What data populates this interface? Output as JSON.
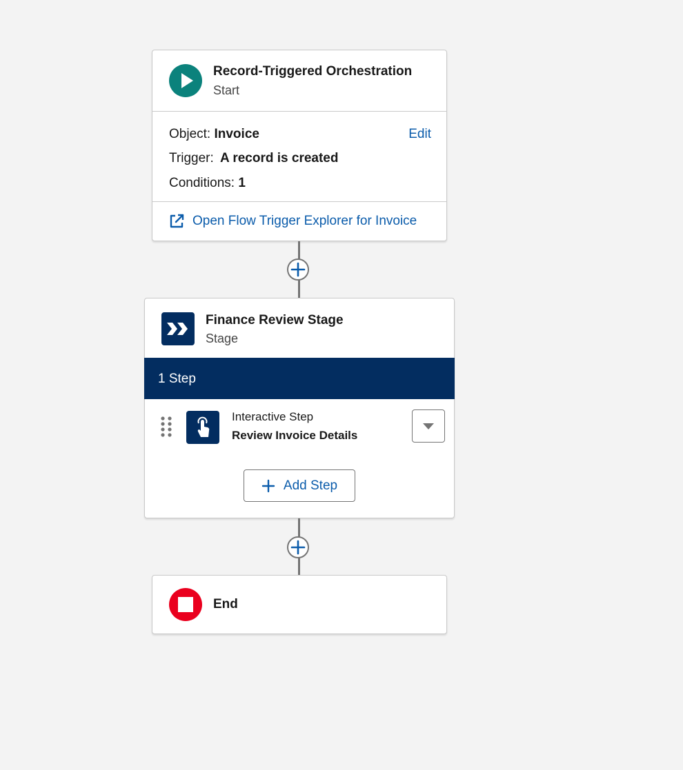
{
  "colors": {
    "start_icon": "#0b827c",
    "stage_navy": "#032d60",
    "end_icon": "#ea001e",
    "link_blue": "#0b5cab",
    "connector": "#747474",
    "canvas": "#f3f3f3"
  },
  "start": {
    "icon": "play-icon",
    "title": "Record-Triggered Orchestration",
    "subtitle": "Start",
    "object_label": "Object:",
    "object_value": "Invoice",
    "edit_label": "Edit",
    "trigger_label": "Trigger:",
    "trigger_value": "A record is created",
    "conditions_label": "Conditions:",
    "conditions_value": "1",
    "explorer_icon": "external-link-icon",
    "explorer_link": "Open Flow Trigger Explorer for Invoice"
  },
  "stage": {
    "icon": "chevrons-right-icon",
    "title": "Finance Review Stage",
    "subtitle": "Stage",
    "step_count": "1 Step",
    "steps": [
      {
        "icon": "touch-hand-icon",
        "type": "Interactive Step",
        "name": "Review Invoice Details"
      }
    ],
    "add_step_label": "Add Step"
  },
  "end": {
    "icon": "stop-icon",
    "title": "End"
  }
}
